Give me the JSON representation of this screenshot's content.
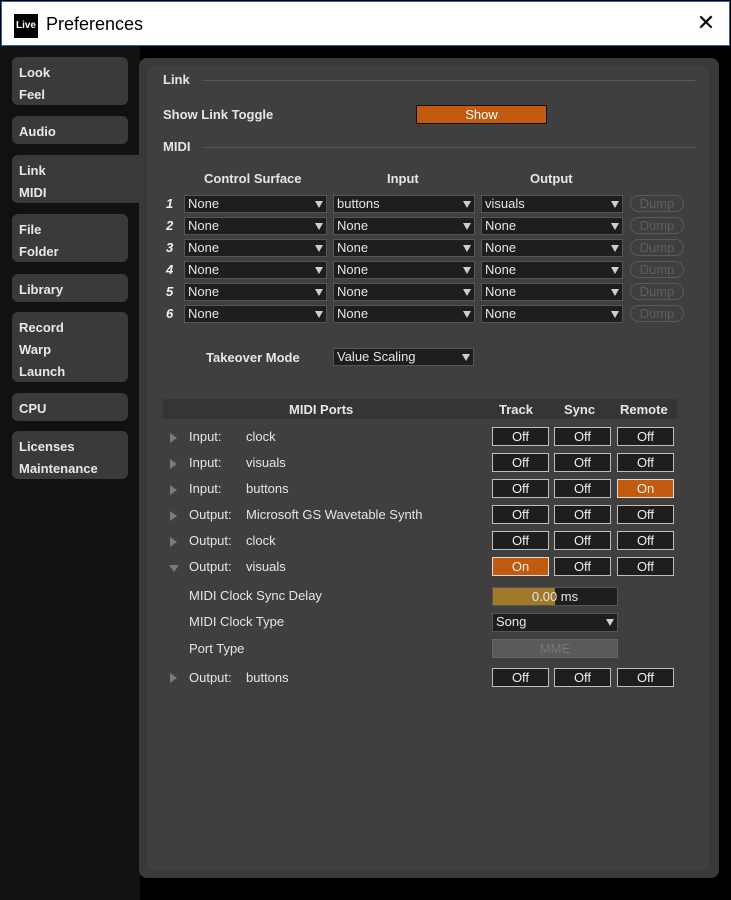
{
  "window": {
    "title": "Preferences",
    "logo": "Live"
  },
  "sidebar": {
    "tabs": [
      {
        "lines": [
          "Look",
          "Feel"
        ]
      },
      {
        "lines": [
          "Audio"
        ]
      },
      {
        "lines": [
          "Link",
          "MIDI"
        ]
      },
      {
        "lines": [
          "File",
          "Folder"
        ]
      },
      {
        "lines": [
          "Library"
        ]
      },
      {
        "lines": [
          "Record",
          "Warp",
          "Launch"
        ]
      },
      {
        "lines": [
          "CPU"
        ]
      },
      {
        "lines": [
          "Licenses",
          "Maintenance"
        ]
      }
    ]
  },
  "link": {
    "section_title": "Link",
    "toggle_label": "Show Link Toggle",
    "toggle_button": "Show"
  },
  "midi": {
    "section_title": "MIDI",
    "headers": {
      "control_surface": "Control Surface",
      "input": "Input",
      "output": "Output"
    },
    "rows": [
      {
        "num": "1",
        "surface": "None",
        "input": "buttons",
        "output": "visuals",
        "dump": "Dump"
      },
      {
        "num": "2",
        "surface": "None",
        "input": "None",
        "output": "None",
        "dump": "Dump"
      },
      {
        "num": "3",
        "surface": "None",
        "input": "None",
        "output": "None",
        "dump": "Dump"
      },
      {
        "num": "4",
        "surface": "None",
        "input": "None",
        "output": "None",
        "dump": "Dump"
      },
      {
        "num": "5",
        "surface": "None",
        "input": "None",
        "output": "None",
        "dump": "Dump"
      },
      {
        "num": "6",
        "surface": "None",
        "input": "None",
        "output": "None",
        "dump": "Dump"
      }
    ],
    "takeover_label": "Takeover Mode",
    "takeover_value": "Value Scaling"
  },
  "ports": {
    "headers": {
      "ports": "MIDI Ports",
      "track": "Track",
      "sync": "Sync",
      "remote": "Remote"
    },
    "rows": [
      {
        "kind": "Input:",
        "name": "clock",
        "track": "Off",
        "sync": "Off",
        "remote": "Off"
      },
      {
        "kind": "Input:",
        "name": "visuals",
        "track": "Off",
        "sync": "Off",
        "remote": "Off"
      },
      {
        "kind": "Input:",
        "name": "buttons",
        "track": "Off",
        "sync": "Off",
        "remote": "On"
      },
      {
        "kind": "Output:",
        "name": "Microsoft GS Wavetable Synth",
        "track": "Off",
        "sync": "Off",
        "remote": "Off"
      },
      {
        "kind": "Output:",
        "name": "clock",
        "track": "Off",
        "sync": "Off",
        "remote": "Off"
      },
      {
        "kind": "Output:",
        "name": "visuals",
        "track": "On",
        "sync": "Off",
        "remote": "Off"
      }
    ],
    "expanded": {
      "sync_delay_label": "MIDI Clock Sync Delay",
      "sync_delay_value": "0.00 ms",
      "sync_delay_fraction": 0.5,
      "clock_type_label": "MIDI Clock Type",
      "clock_type_value": "Song",
      "port_type_label": "Port Type",
      "port_type_value": "MME"
    },
    "last_row": {
      "kind": "Output:",
      "name": "buttons",
      "track": "Off",
      "sync": "Off",
      "remote": "Off"
    }
  },
  "colors": {
    "accent": "#c25a0f",
    "panel": "#393939",
    "slider_fill": "#a07a2a"
  }
}
